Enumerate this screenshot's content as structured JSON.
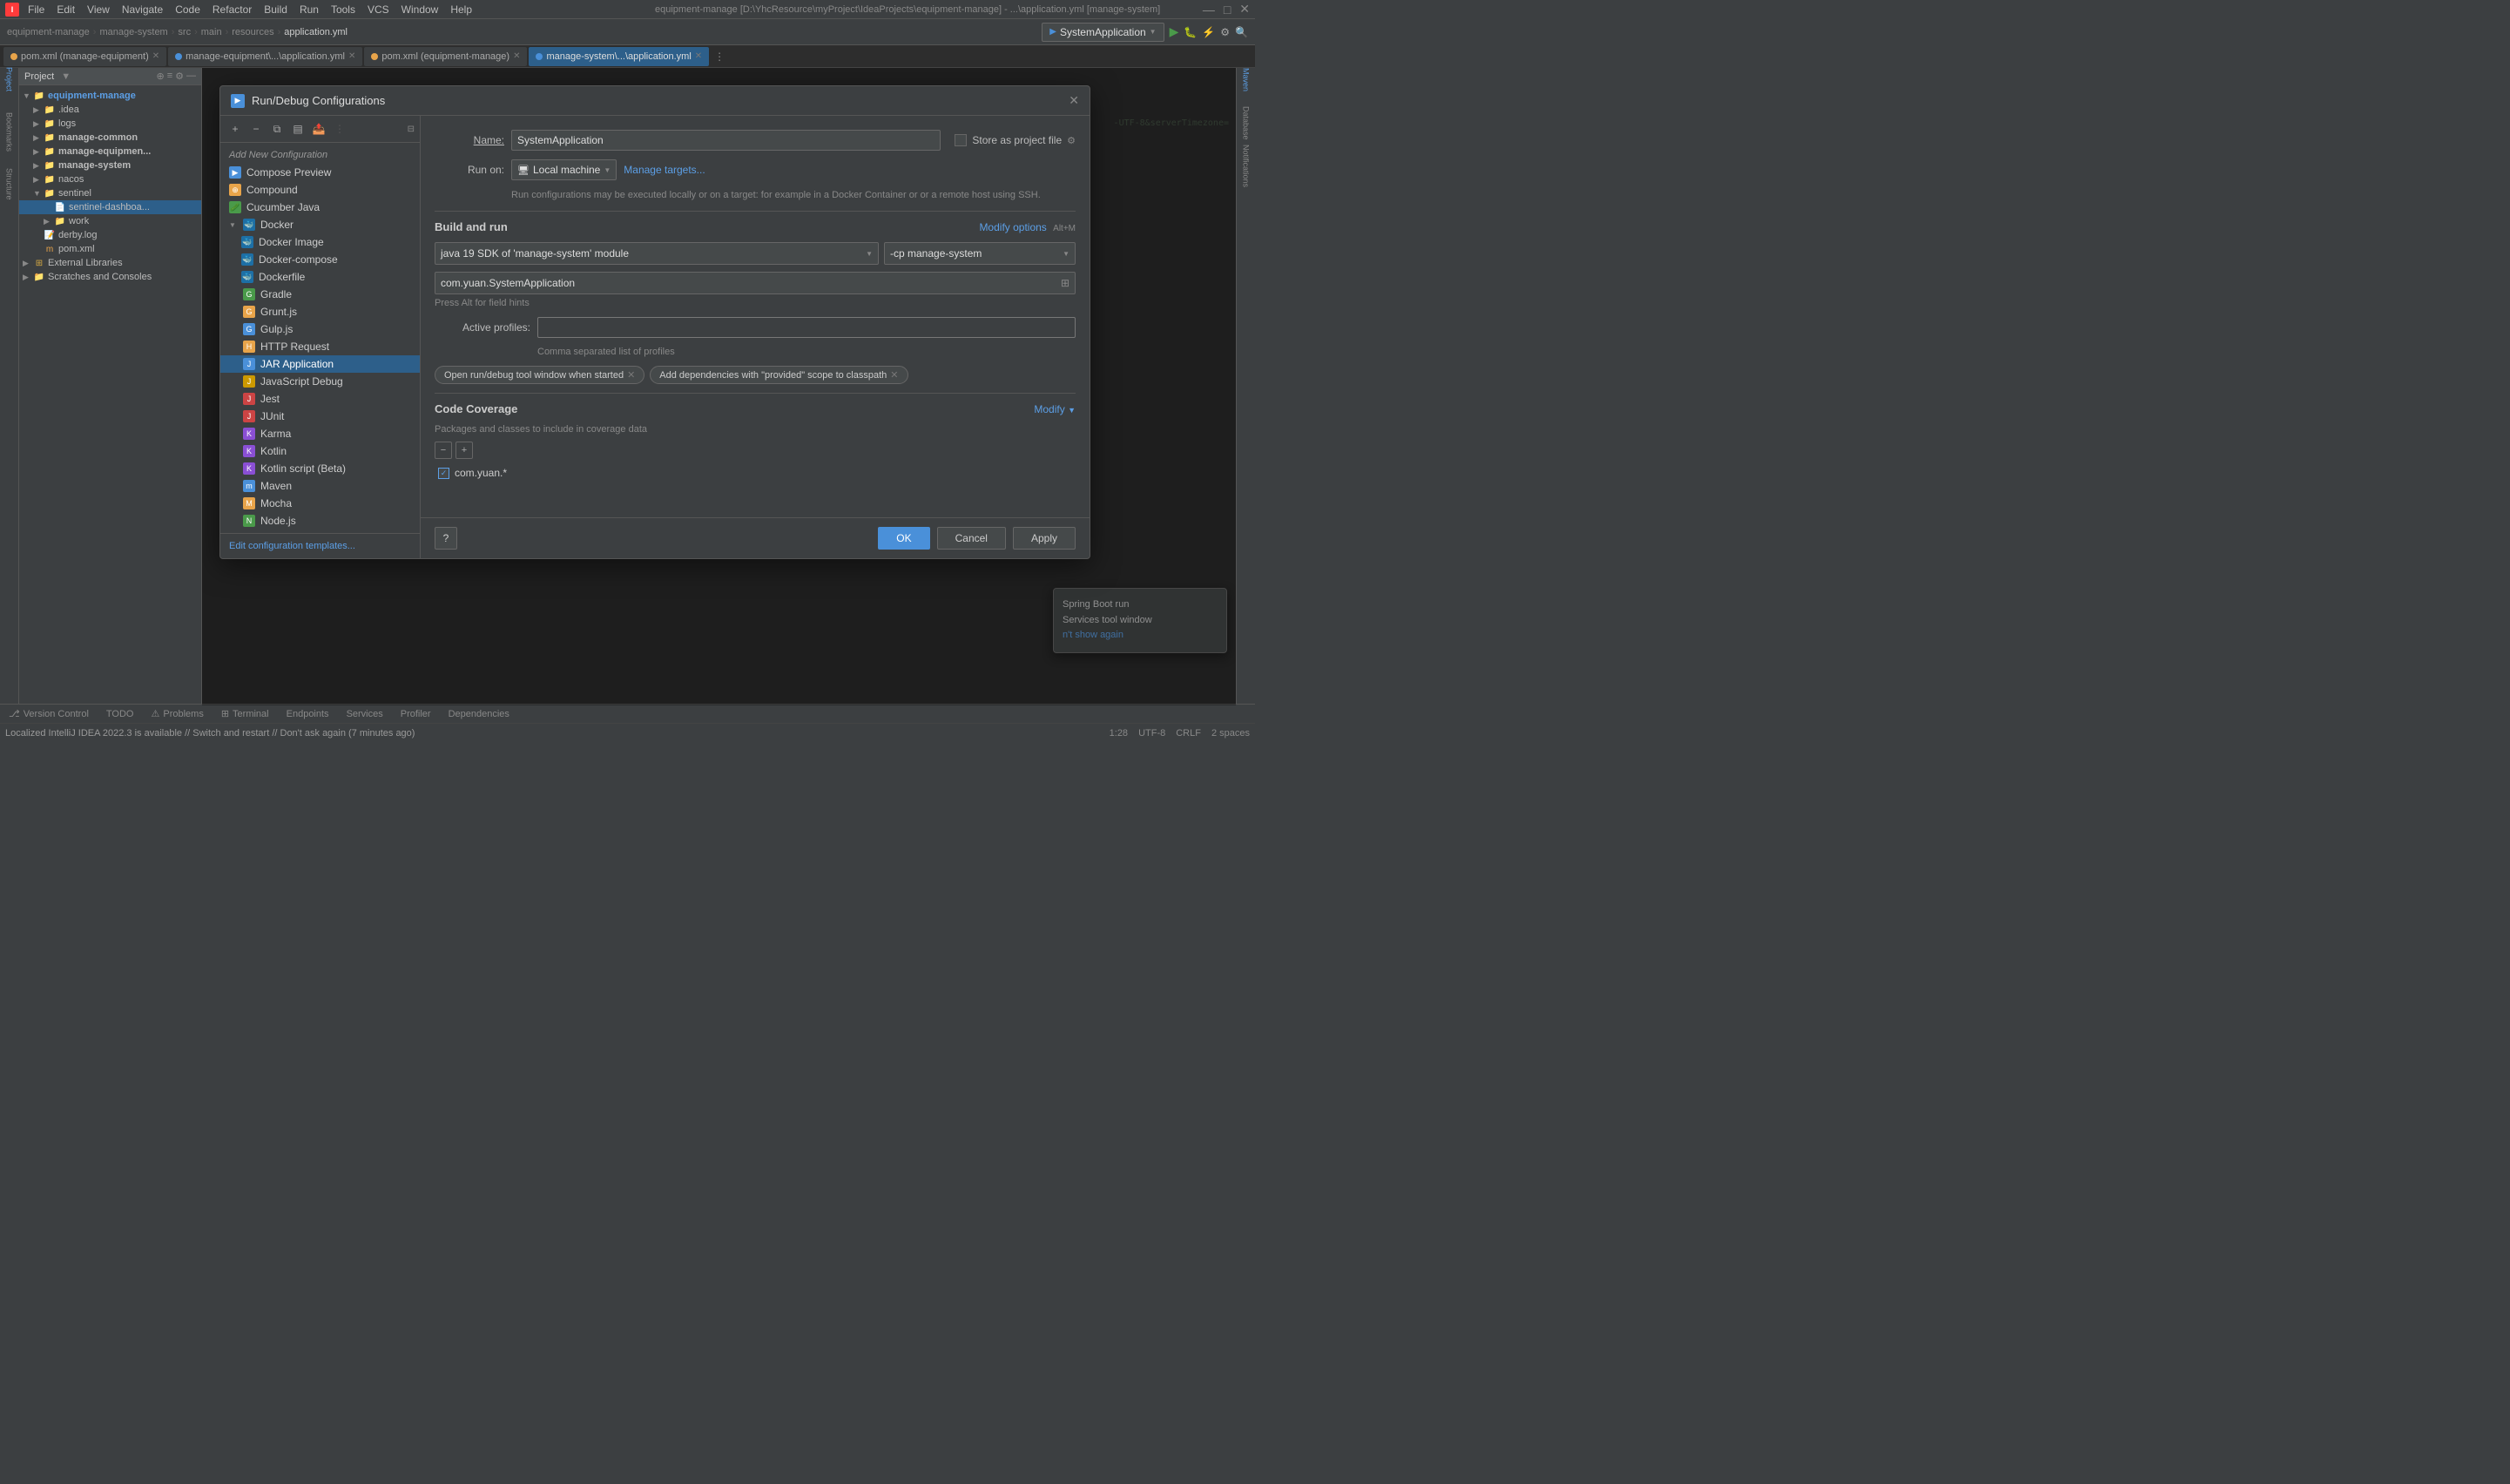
{
  "titleBar": {
    "title": "equipment-manage [D:\\YhcResource\\myProject\\IdeaProjects\\equipment-manage] - ...\\application.yml [manage-system]",
    "logo": "I"
  },
  "menuBar": {
    "items": [
      "File",
      "Edit",
      "View",
      "Navigate",
      "Code",
      "Refactor",
      "Build",
      "Run",
      "Tools",
      "VCS",
      "Window",
      "Help"
    ]
  },
  "toolbar": {
    "projectName": "equipment-manage",
    "branchName": "manage-system",
    "srcPath": "src",
    "mainPath": "main",
    "resourcesPath": "resources",
    "fileName": "application.yml",
    "runConfig": "SystemApplication"
  },
  "fileTabs": [
    {
      "name": "pom.xml (manage-equipment)",
      "type": "orange",
      "active": false
    },
    {
      "name": "manage-equipment\\...\\application.yml",
      "type": "blue",
      "active": false
    },
    {
      "name": "pom.xml (equipment-manage)",
      "type": "orange",
      "active": false
    },
    {
      "name": "manage-system\\...\\application.yml",
      "type": "blue",
      "active": true
    }
  ],
  "projectTree": {
    "root": "equipment-manage",
    "items": [
      {
        "label": ".idea",
        "type": "folder",
        "indent": 1,
        "expanded": false
      },
      {
        "label": "logs",
        "type": "folder",
        "indent": 1,
        "expanded": false
      },
      {
        "label": "manage-common",
        "type": "folder",
        "indent": 1,
        "expanded": false
      },
      {
        "label": "manage-equipmen...",
        "type": "folder",
        "indent": 1,
        "expanded": false
      },
      {
        "label": "manage-system",
        "type": "folder",
        "indent": 1,
        "expanded": false
      },
      {
        "label": "nacos",
        "type": "folder",
        "indent": 1,
        "expanded": false
      },
      {
        "label": "sentinel",
        "type": "folder",
        "indent": 1,
        "expanded": true
      },
      {
        "label": "sentinel-dashboa...",
        "type": "file",
        "indent": 2
      },
      {
        "label": "work",
        "type": "folder",
        "indent": 2,
        "expanded": false
      },
      {
        "label": "derby.log",
        "type": "file",
        "indent": 1
      },
      {
        "label": "pom.xml",
        "type": "file",
        "indent": 1
      },
      {
        "label": "External Libraries",
        "type": "folder",
        "indent": 0,
        "expanded": false
      },
      {
        "label": "Scratches and Consoles",
        "type": "folder",
        "indent": 0,
        "expanded": false
      }
    ]
  },
  "dialog": {
    "title": "Run/Debug Configurations",
    "toolbar": {
      "add": "+",
      "remove": "−",
      "copy": "⧉",
      "save": "💾",
      "share": "📤",
      "more": "⋮"
    },
    "configList": {
      "sectionLabel": "Add New Configuration",
      "items": [
        {
          "label": "Compose Preview",
          "icon": "blue",
          "selected": false
        },
        {
          "label": "Compound",
          "icon": "orange",
          "selected": false
        },
        {
          "label": "Cucumber Java",
          "icon": "green",
          "selected": false
        },
        {
          "label": "Docker",
          "icon": "docker",
          "selected": false,
          "hasChildren": true
        },
        {
          "label": "Docker Image",
          "icon": "docker",
          "selected": false,
          "indent": true
        },
        {
          "label": "Docker-compose",
          "icon": "docker",
          "selected": false,
          "indent": true
        },
        {
          "label": "Dockerfile",
          "icon": "docker",
          "selected": false,
          "indent": true
        },
        {
          "label": "Gradle",
          "icon": "green",
          "selected": false
        },
        {
          "label": "Grunt.js",
          "icon": "orange",
          "selected": false
        },
        {
          "label": "Gulp.js",
          "icon": "blue",
          "selected": false
        },
        {
          "label": "HTTP Request",
          "icon": "orange",
          "selected": false
        },
        {
          "label": "JAR Application",
          "icon": "blue",
          "selected": true
        },
        {
          "label": "JavaScript Debug",
          "icon": "yellow",
          "selected": false
        },
        {
          "label": "Jest",
          "icon": "red",
          "selected": false
        },
        {
          "label": "JUnit",
          "icon": "red",
          "selected": false
        },
        {
          "label": "Karma",
          "icon": "purple",
          "selected": false
        },
        {
          "label": "Kotlin",
          "icon": "purple",
          "selected": false
        },
        {
          "label": "Kotlin script (Beta)",
          "icon": "purple",
          "selected": false
        },
        {
          "label": "Maven",
          "icon": "blue",
          "selected": false
        },
        {
          "label": "Mocha",
          "icon": "orange",
          "selected": false
        },
        {
          "label": "Node.js",
          "icon": "green",
          "selected": false
        }
      ],
      "editTemplates": "Edit configuration templates..."
    },
    "rightPanel": {
      "nameLabel": "Name:",
      "nameValue": "SystemApplication",
      "storeAsProjectFile": "Store as project file",
      "runOnLabel": "Run on:",
      "runOnValue": "Local machine",
      "manageTargets": "Manage targets...",
      "hintText": "Run configurations may be executed locally or on a target: for example in a Docker Container or or a remote host using SSH.",
      "buildRunTitle": "Build and run",
      "modifyOptions": "Modify options",
      "modifyShortcut": "Alt+M",
      "sdkValue": "java 19 SDK of 'manage-system' module",
      "cpValue": "-cp manage-system",
      "mainClass": "com.yuan.SystemApplication",
      "pressHint": "Press Alt for field hints",
      "activeProfilesLabel": "Active profiles:",
      "activeProfilesPlaceholder": "",
      "profilesHint": "Comma separated list of profiles",
      "tag1": "Open run/debug tool window when started",
      "tag2": "Add dependencies with \"provided\" scope to classpath",
      "codeCoverageTitle": "Code Coverage",
      "modifyLink": "Modify",
      "coverageHint": "Packages and classes to include in coverage data",
      "coverageItem": "com.yuan.*"
    }
  },
  "dialogButtons": {
    "ok": "OK",
    "cancel": "Cancel",
    "apply": "Apply"
  },
  "bottomBar": {
    "tabs": [
      "Version Control",
      "TODO",
      "Problems",
      "Terminal",
      "Endpoints",
      "Services",
      "Profiler",
      "Dependencies"
    ]
  },
  "statusBar": {
    "message": "Localized IntelliJ IDEA 2022.3 is available // Switch and restart // Don't ask again (7 minutes ago)",
    "encoding": "UTF-8",
    "lineEnding": "CRLF",
    "indent": "2 spaces",
    "line": "1:28"
  },
  "notification": {
    "line1": "Spring Boot run",
    "line2": "Services tool window",
    "line3": "n't show again"
  },
  "icons": {
    "plus": "+",
    "minus": "−",
    "copy": "⧉",
    "save": "▤",
    "folder": "📁",
    "file": "📄",
    "arrow_right": "▶",
    "arrow_down": "▼",
    "check": "✓",
    "close": "✕",
    "gear": "⚙",
    "run": "▶",
    "debug": "🐛",
    "search": "🔍"
  }
}
